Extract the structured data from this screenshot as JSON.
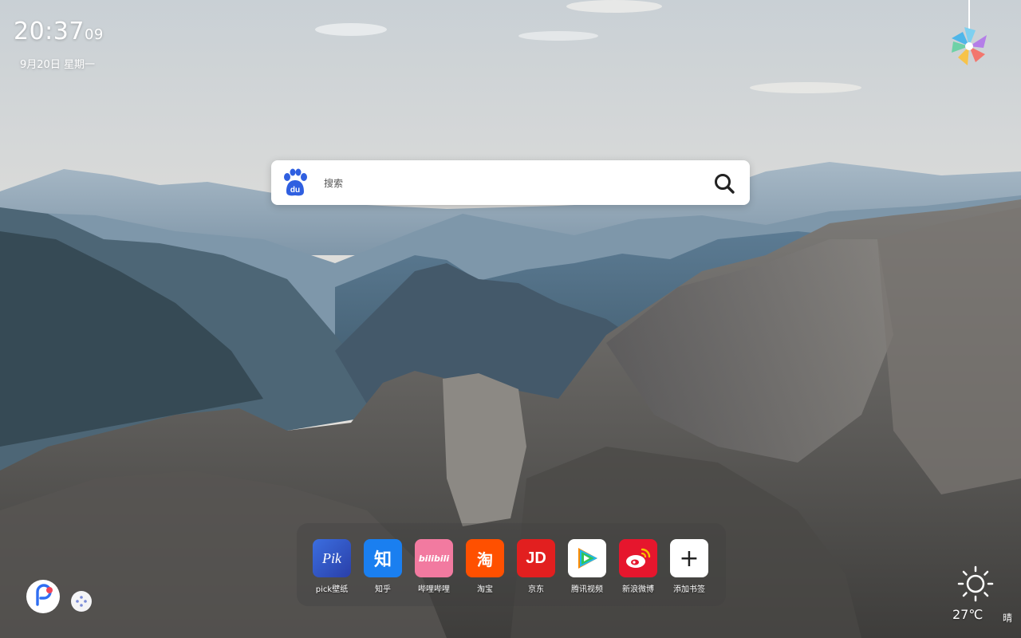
{
  "clock": {
    "time": "20:37",
    "seconds": "09",
    "date": "9月20日 星期一"
  },
  "search": {
    "placeholder": "搜索",
    "engine_icon": "baidu-paw-icon"
  },
  "dock": {
    "apps": [
      {
        "label": "pick壁纸",
        "tile_text": "Pik",
        "color": "#2f57c8",
        "icon": "pick-wallpaper-icon"
      },
      {
        "label": "知乎",
        "tile_text": "知",
        "color": "#1a7ff0",
        "icon": "zhihu-icon"
      },
      {
        "label": "哔哩哔哩",
        "tile_text": "bilibili",
        "color": "#f27aa0",
        "icon": "bilibili-icon"
      },
      {
        "label": "淘宝",
        "tile_text": "淘",
        "color": "#ff5000",
        "icon": "taobao-icon"
      },
      {
        "label": "京东",
        "tile_text": "JD",
        "color": "#e21f1f",
        "icon": "jd-icon"
      },
      {
        "label": "腾讯视频",
        "tile_text": "",
        "color": "#ffffff",
        "icon": "tencent-video-icon"
      },
      {
        "label": "新浪微博",
        "tile_text": "",
        "color": "#e6162d",
        "icon": "weibo-icon"
      },
      {
        "label": "添加书签",
        "tile_text": "+",
        "color": "#ffffff",
        "icon": "add-bookmark-icon"
      }
    ]
  },
  "weather": {
    "temperature": "27℃",
    "condition": "晴",
    "icon": "sun-icon"
  },
  "bottom_left": {
    "assistant_icon": "assistant-logo-icon",
    "menu_icon": "dots-menu-icon"
  },
  "decor": {
    "pendant_icon": "pinwheel-icon"
  }
}
